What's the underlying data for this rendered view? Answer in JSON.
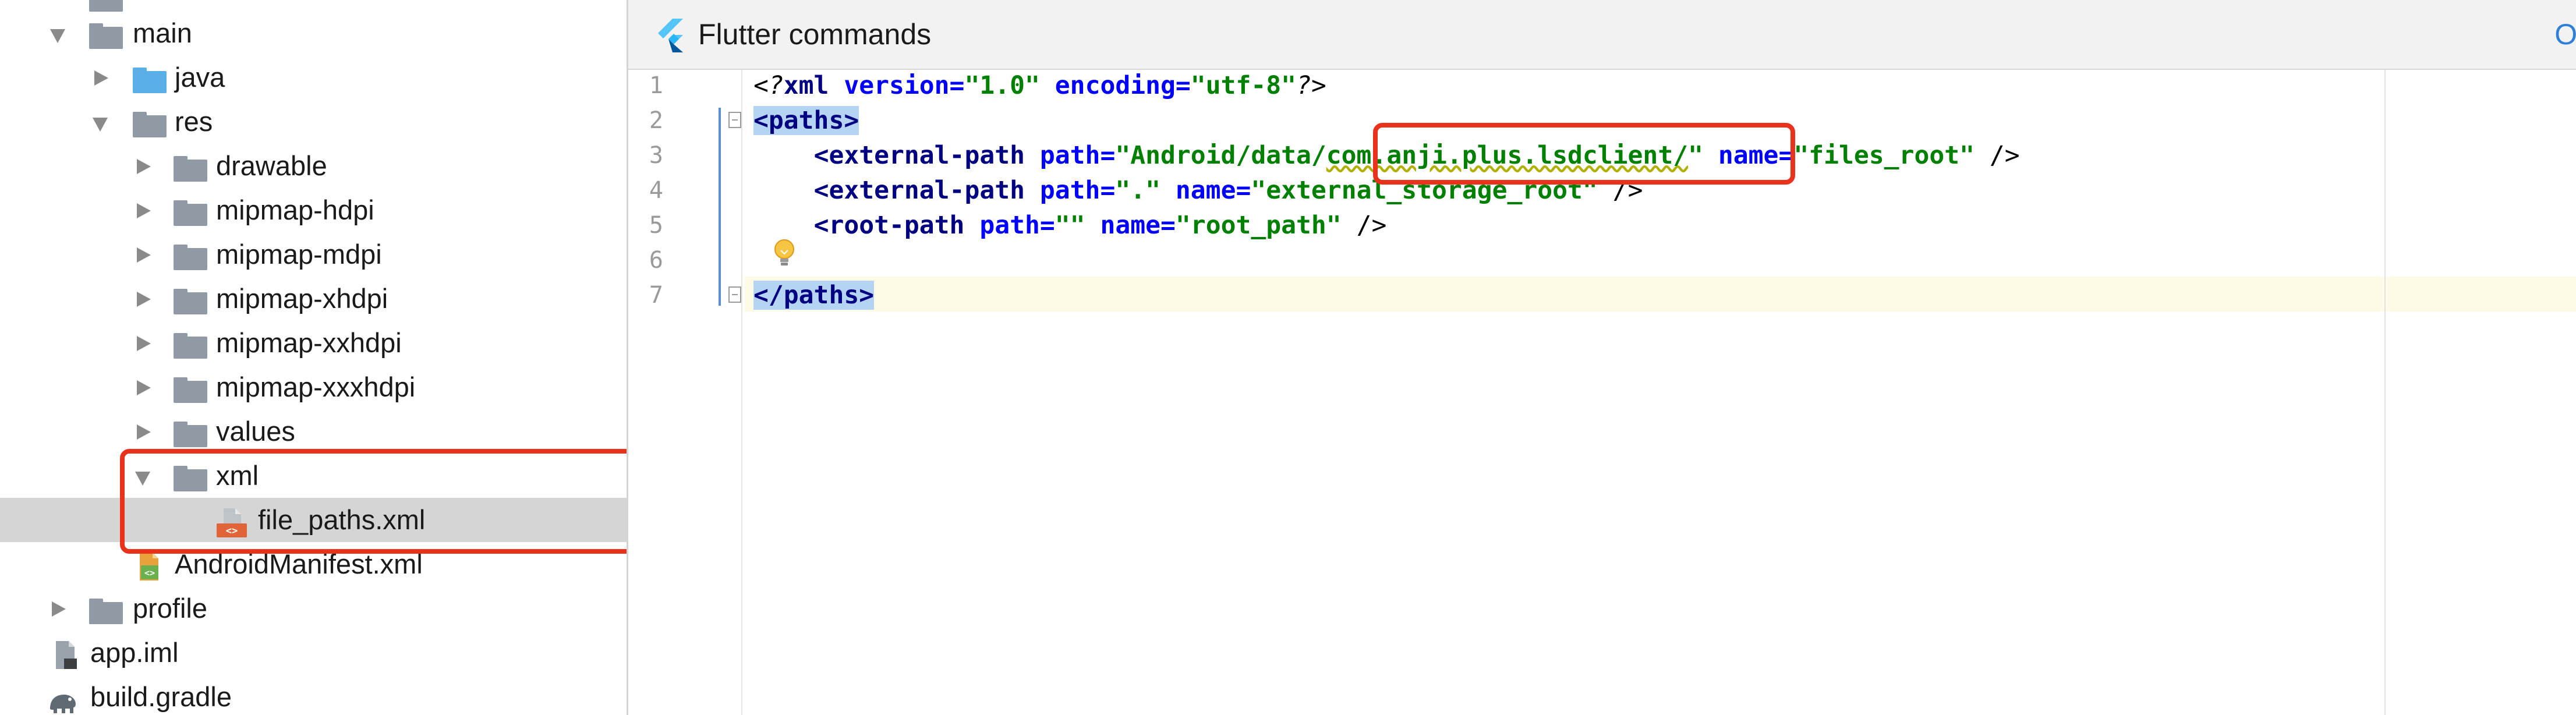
{
  "project_tree": {
    "items": [
      {
        "label": "main"
      },
      {
        "label": "java"
      },
      {
        "label": "res"
      },
      {
        "label": "drawable"
      },
      {
        "label": "mipmap-hdpi"
      },
      {
        "label": "mipmap-mdpi"
      },
      {
        "label": "mipmap-xhdpi"
      },
      {
        "label": "mipmap-xxhdpi"
      },
      {
        "label": "mipmap-xxxhdpi"
      },
      {
        "label": "values"
      },
      {
        "label": "xml"
      },
      {
        "label": "file_paths.xml"
      },
      {
        "label": "AndroidManifest.xml"
      },
      {
        "label": "profile"
      },
      {
        "label": "app.iml"
      },
      {
        "label": "build.gradle"
      }
    ],
    "selected_item": "file_paths.xml"
  },
  "editor": {
    "banner": {
      "title": "Flutter commands",
      "link": "Op"
    },
    "line_numbers": [
      "1",
      "2",
      "3",
      "4",
      "5",
      "6",
      "7"
    ],
    "current_line": 7,
    "lines": {
      "l1": {
        "open": "<?",
        "tag": "xml",
        "a1": " version=",
        "v1": "\"1.0\"",
        "a2": " encoding=",
        "v2": "\"utf-8\"",
        "close": "?>"
      },
      "l2": {
        "tag": "<paths>"
      },
      "l3": {
        "indent": "    ",
        "tag_open": "<external-path",
        "a1": " path=",
        "v1a": "\"Android/data/",
        "v1b": "com.anji.plus.lsdclient/",
        "v1c": "\"",
        "a2": " name=",
        "v2": "\"files_root\"",
        "close": " />"
      },
      "l4": {
        "indent": "    ",
        "tag_open": "<external-path",
        "a1": " path=",
        "v1": "\".\"",
        "a2": " name=",
        "v2": "\"external_storage_root\"",
        "close": " />"
      },
      "l5": {
        "indent": "    ",
        "tag_open": "<root-path",
        "a1": " path=",
        "v1": "\"\"",
        "a2": " name=",
        "v2": "\"root_path\"",
        "close": " />"
      },
      "l7": {
        "tag": "</paths>"
      }
    }
  },
  "colors": {
    "annotation_red": "#e8321c",
    "selection_blue": "#b5d3f3",
    "tag_navy": "#000080",
    "attr_blue": "#0000ff",
    "value_green": "#008000"
  },
  "icons": [
    "folder-icon",
    "source-folder-icon",
    "xml-file-icon",
    "manifest-file-icon",
    "iml-file-icon",
    "gradle-icon",
    "flutter-logo-icon",
    "lightbulb-icon",
    "fold-marker-icon",
    "expand-arrow-icon",
    "collapse-arrow-icon"
  ]
}
